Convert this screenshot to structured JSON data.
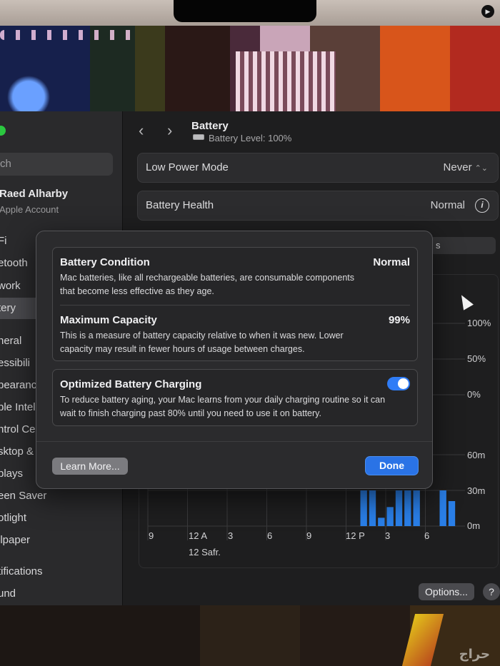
{
  "colors": {
    "accent": "#2a73e6",
    "bar": "#2a7fe8",
    "toggle_on": "#2f7cf6"
  },
  "sidebar": {
    "search_placeholder": "ch",
    "account_name": "Raed Alharby",
    "account_sub": "Apple Account",
    "items": [
      {
        "label": "Fi"
      },
      {
        "label": "etooth"
      },
      {
        "label": "work"
      },
      {
        "label": "tery"
      },
      {
        "label": "neral"
      },
      {
        "label": "essibili"
      },
      {
        "label": "pearanc"
      },
      {
        "label": "ple Intell"
      },
      {
        "label": "ntrol Ce"
      },
      {
        "label": "sktop &"
      },
      {
        "label": "plays"
      },
      {
        "label": "een Saver"
      },
      {
        "label": "otlight"
      },
      {
        "label": "llpaper"
      },
      {
        "label": "tifications"
      },
      {
        "label": "und"
      }
    ]
  },
  "header": {
    "back_icon": "chevron-left-icon",
    "forward_icon": "chevron-right-icon",
    "title": "Battery",
    "subtitle": "Battery Level: 100%"
  },
  "rows": {
    "low_power_label": "Low Power Mode",
    "low_power_value": "Never",
    "health_label": "Battery Health",
    "health_value": "Normal",
    "partial_hidden_text": "s"
  },
  "chart_data": {
    "type": "bar",
    "level_axis_ticks": [
      "100%",
      "50%",
      "0%"
    ],
    "usage_axis_ticks": [
      "60m",
      "30m",
      "0m"
    ],
    "x_tick_labels": [
      "9",
      "12 A",
      "3",
      "6",
      "9",
      "12 P",
      "3",
      "6"
    ],
    "date_label": "12 Safr.",
    "usage_bars_minutes": [
      0,
      0,
      0,
      0,
      0,
      0,
      0,
      0,
      0,
      0,
      0,
      0,
      0,
      0,
      0,
      0,
      0,
      0,
      0,
      0,
      0,
      0,
      0,
      0,
      30,
      30,
      7,
      16,
      30,
      30,
      30,
      0,
      0,
      30,
      21,
      0
    ],
    "ylim_minutes": [
      0,
      60
    ]
  },
  "buttons": {
    "options": "Options...",
    "help": "?"
  },
  "sheet": {
    "condition_title": "Battery Condition",
    "condition_value": "Normal",
    "condition_desc": "Mac batteries, like all rechargeable batteries, are consumable components that become less effective as they age.",
    "capacity_title": "Maximum Capacity",
    "capacity_value": "99%",
    "capacity_desc": "This is a measure of battery capacity relative to when it was new. Lower capacity may result in fewer hours of usage between charges.",
    "optimized_title": "Optimized Battery Charging",
    "optimized_on": true,
    "optimized_desc": "To reduce battery aging, your Mac learns from your daily charging routine so it can wait to finish charging past 80% until you need to use it on battery.",
    "learn_more": "Learn More...",
    "done": "Done"
  },
  "wallpaper": {
    "watermark": "حراج"
  }
}
